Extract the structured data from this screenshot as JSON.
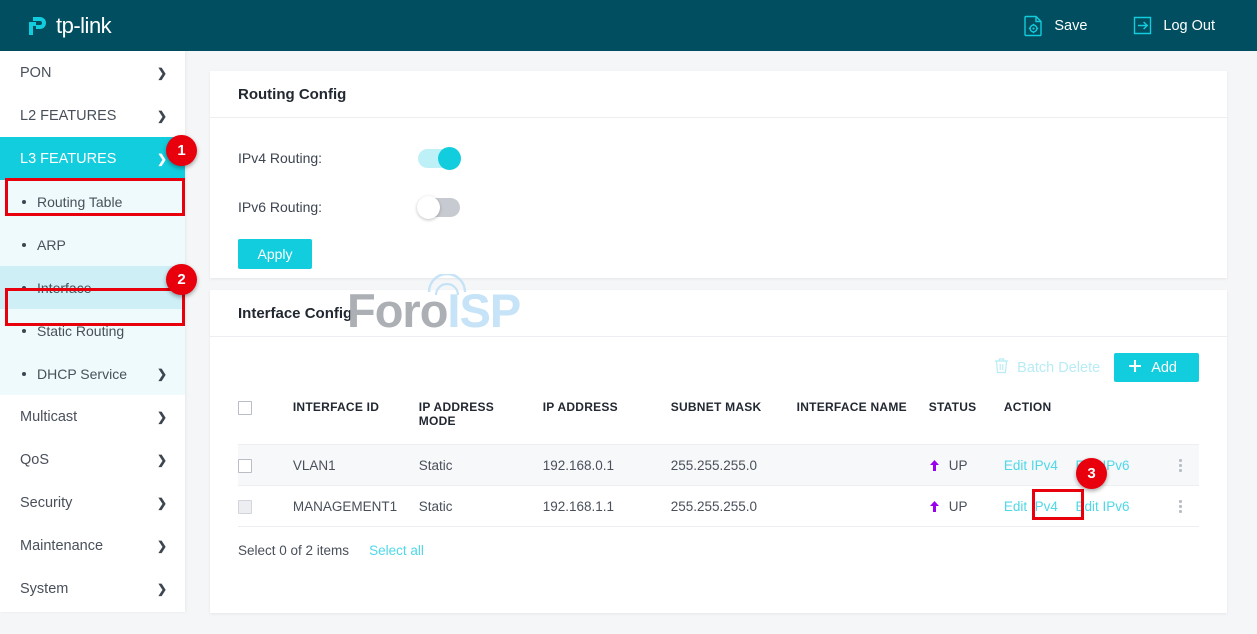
{
  "header": {
    "brand": "tp-link",
    "brand_icon": "tp-link-logo-icon",
    "save_label": "Save",
    "save_icon": "save-gear-document-icon",
    "logout_label": "Log Out",
    "logout_icon": "logout-arrow-icon",
    "background_color": "#004e5f"
  },
  "sidebar": {
    "items": [
      {
        "label": "PON",
        "icon": "chevron-right-icon",
        "state": "collapsed"
      },
      {
        "label": "L2 FEATURES",
        "icon": "chevron-right-icon",
        "state": "collapsed"
      },
      {
        "label": "L3 FEATURES",
        "icon": "chevron-down-icon",
        "state": "expanded"
      }
    ],
    "sub_items": [
      {
        "label": "Routing Table",
        "icon": "bullet-dot-icon",
        "has_chevron": false,
        "selected": false
      },
      {
        "label": "ARP",
        "icon": "bullet-dot-icon",
        "has_chevron": false,
        "selected": false
      },
      {
        "label": "Interface",
        "icon": "bullet-dot-icon",
        "has_chevron": false,
        "selected": true
      },
      {
        "label": "Static Routing",
        "icon": "bullet-dot-icon",
        "has_chevron": false,
        "selected": false
      },
      {
        "label": "DHCP Service",
        "icon": "bullet-dot-icon",
        "has_chevron": true,
        "selected": false
      }
    ],
    "items_after": [
      {
        "label": "Multicast",
        "icon": "chevron-right-icon"
      },
      {
        "label": "QoS",
        "icon": "chevron-right-icon"
      },
      {
        "label": "Security",
        "icon": "chevron-right-icon"
      },
      {
        "label": "Maintenance",
        "icon": "chevron-right-icon"
      },
      {
        "label": "System",
        "icon": "chevron-right-icon"
      }
    ],
    "active_color": "#12cddd",
    "subgroup_bg": "#eefafc",
    "selected_bg": "#cdeff5"
  },
  "routing_config": {
    "title": "Routing Config",
    "ipv4_label": "IPv4 Routing:",
    "ipv4_state": "on",
    "ipv6_label": "IPv6 Routing:",
    "ipv6_state": "off",
    "apply_label": "Apply"
  },
  "interface_config": {
    "title": "Interface Config",
    "batch_delete_label": "Batch Delete",
    "batch_delete_icon": "trash-icon",
    "batch_delete_disabled": true,
    "add_label": "Add",
    "add_icon": "plus-icon",
    "columns": [
      "INTERFACE ID",
      "IP ADDRESS MODE",
      "IP ADDRESS",
      "SUBNET MASK",
      "INTERFACE NAME",
      "STATUS",
      "ACTION"
    ],
    "rows": [
      {
        "checkbox": "unchecked",
        "checkbox_disabled": false,
        "interface_id": "VLAN1",
        "ip_address_mode": "Static",
        "ip_address": "192.168.0.1",
        "subnet_mask": "255.255.255.0",
        "interface_name": "",
        "status": "UP",
        "status_icon": "arrow-up-icon",
        "action_ipv4": "Edit IPv4",
        "action_ipv6": "Edit IPv6",
        "menu_icon": "kebab-menu-icon"
      },
      {
        "checkbox": "unchecked",
        "checkbox_disabled": true,
        "interface_id": "MANAGEMENT1",
        "ip_address_mode": "Static",
        "ip_address": "192.168.1.1",
        "subnet_mask": "255.255.255.0",
        "interface_name": "",
        "status": "UP",
        "status_icon": "arrow-up-icon",
        "action_ipv4": "Edit IPv4",
        "action_ipv6": "Edit IPv6",
        "menu_icon": "kebab-menu-icon"
      }
    ],
    "footer_count": "Select 0 of 2 items",
    "select_all_label": "Select all",
    "status_arrow_color": "#9b00ee",
    "link_color": "#4ed8e8"
  },
  "watermark": {
    "part1": "Foro",
    "part2": "ISP",
    "icon": "wifi-arc-icon"
  },
  "annotations": [
    {
      "number": "1",
      "target": "sidebar-item-l3-features"
    },
    {
      "number": "2",
      "target": "sidebar-subitem-interface"
    },
    {
      "number": "3",
      "target": "row-2-edit-ipv4-link"
    }
  ],
  "annotation_color": "#e8000d"
}
